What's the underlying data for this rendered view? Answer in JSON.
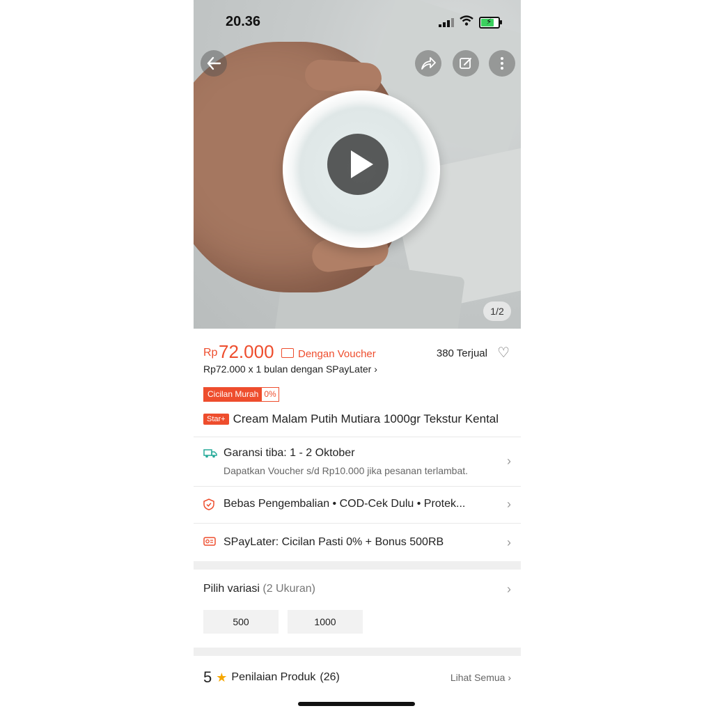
{
  "status_bar": {
    "time": "20.36"
  },
  "media": {
    "counter": "1/2"
  },
  "product": {
    "currency": "Rp",
    "price": "72.000",
    "voucher_label": "Dengan Voucher",
    "sold": "380 Terjual",
    "spaylater_prefix": "Rp72.000 x 1 bulan dengan ",
    "spaylater_brand": "SPayLater",
    "installment_badge": "Cicilan Murah",
    "installment_rate": "0%",
    "star_badge": "Star+",
    "title": "Cream Malam Putih Mutiara 1000gr Tekstur Kental"
  },
  "shipping": {
    "main": "Garansi tiba: 1 - 2 Oktober",
    "sub": "Dapatkan Voucher s/d Rp10.000 jika pesanan terlambat."
  },
  "guarantees": {
    "text": "Bebas Pengembalian  •  COD-Cek Dulu  •  Protek..."
  },
  "spaylater_promo": {
    "text": "SPayLater: Cicilan Pasti 0% + Bonus 500RB"
  },
  "variation": {
    "label": "Pilih variasi",
    "count": "(2 Ukuran)",
    "options": [
      "500",
      "1000"
    ]
  },
  "rating": {
    "score": "5",
    "label": "Penilaian Produk",
    "count": "(26)",
    "see_all": "Lihat Semua"
  },
  "colors": {
    "accent": "#ee4d2d",
    "star": "#f6a700",
    "battery": "#3bd15f"
  },
  "icons": [
    "back-arrow-icon",
    "share-icon",
    "edit-icon",
    "more-icon",
    "play-icon",
    "voucher-icon",
    "heart-icon",
    "truck-icon",
    "shield-icon",
    "spaylater-icon",
    "chevron-right-icon",
    "star-icon"
  ]
}
